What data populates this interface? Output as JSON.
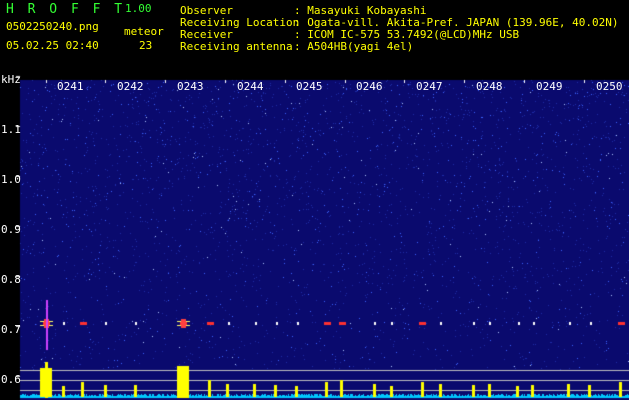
{
  "app": {
    "name": "H R O F F T",
    "version": "1.00",
    "filename": "0502250240.png",
    "datetime": "05.02.25 02:40",
    "meteor_label": "meteor",
    "meteor_count": "23"
  },
  "info": {
    "rows": [
      {
        "label": "Observer",
        "value": ": Masayuki Kobayashi"
      },
      {
        "label": "Receiving Location",
        "value": ": Ogata-vill. Akita-Pref. JAPAN (139.96E, 40.02N)"
      },
      {
        "label": "Receiver",
        "value": ": ICOM IC-575 53.7492(@LCD)MHz USB"
      },
      {
        "label": "Receiving antenna",
        "value": ": A504HB(yagi 4el)"
      }
    ]
  },
  "axes": {
    "y_unit": "kHz",
    "y_ticks": [
      "1.1",
      "1.0",
      "0.9",
      "0.8",
      "0.7",
      "0.6"
    ],
    "x_ticks": [
      "0241",
      "0242",
      "0243",
      "0244",
      "0245",
      "0246",
      "0247",
      "0248",
      "0249",
      "0250"
    ]
  },
  "colors": {
    "background": "#000000",
    "spectrum": "#0a0a6e",
    "noise": "#3c64ff",
    "echo": "#ff3030",
    "level": "#ffff00",
    "baseline": "#00c8ff"
  },
  "echoes": {
    "minutes": [
      0.0,
      0.3,
      0.62,
      1.0,
      1.5,
      2.3,
      2.75,
      3.05,
      3.5,
      3.85,
      4.2,
      4.7,
      4.95,
      5.5,
      5.78,
      6.3,
      6.6,
      7.15,
      7.42,
      7.9,
      8.15,
      8.75,
      9.1,
      9.62
    ],
    "strengths": [
      0.9,
      0.2,
      0.35,
      0.25,
      0.25,
      1.0,
      0.45,
      0.3,
      0.3,
      0.25,
      0.2,
      0.35,
      0.45,
      0.3,
      0.2,
      0.35,
      0.3,
      0.25,
      0.3,
      0.2,
      0.25,
      0.3,
      0.25,
      0.35
    ]
  }
}
